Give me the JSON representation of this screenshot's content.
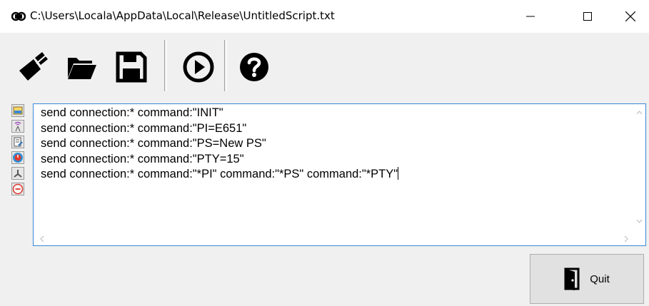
{
  "window": {
    "title": "C:\\Users\\Locala\\AppData\\Local\\Release\\UntitledScript.txt",
    "minimize_label": "—",
    "maximize_label": "☐",
    "close_label": "✕"
  },
  "toolbar": {
    "icons": [
      "brush-clear-icon",
      "open-folder-icon",
      "save-disk-icon",
      "play-icon",
      "help-icon"
    ]
  },
  "sidebar": {
    "icons": [
      "open-connection-icon",
      "broadcast-icon",
      "edit-document-icon",
      "power-icon",
      "network-icon",
      "remove-icon"
    ]
  },
  "editor": {
    "lines": [
      "send connection:* command:\"INIT\"",
      "send connection:* command:\"PI=E651\"",
      "send connection:* command:\"PS=New PS\"",
      "send connection:* command:\"PTY=15\"",
      "send connection:* command:\"*PI\" command:\"*PS\" command:\"*PTY\""
    ]
  },
  "quit_button": {
    "label": "Quit"
  },
  "colors": {
    "accent": "#3b88d6",
    "window_bg": "#f0f0f0",
    "button_bg": "#e1e1e1"
  }
}
